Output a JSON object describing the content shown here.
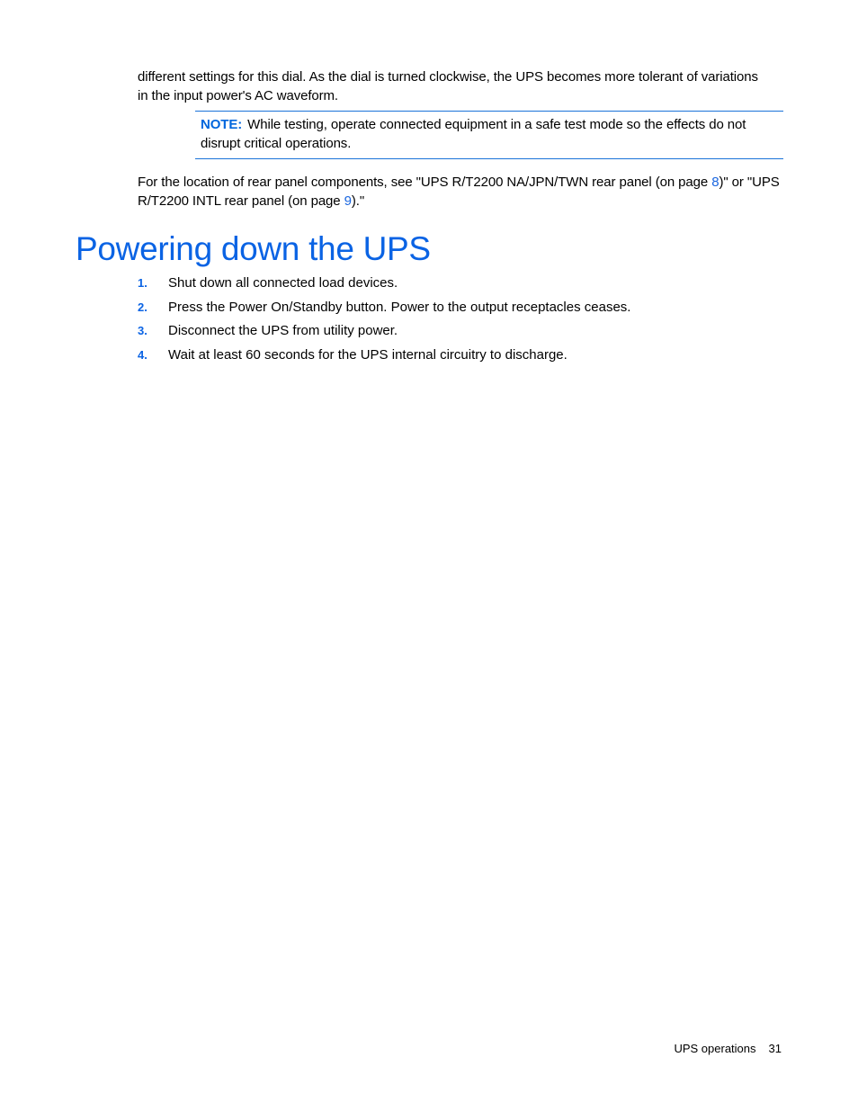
{
  "intro": {
    "line1": "different settings for this dial. As the dial is turned clockwise, the UPS becomes more tolerant of variations",
    "line2": "in the input power's AC waveform."
  },
  "note": {
    "label": "NOTE:",
    "text": "While testing, operate connected equipment in a safe test mode so the effects do not disrupt critical operations."
  },
  "rear_panel": {
    "text_before": "For the location of rear panel components, see \"UPS R/T2200 NA/JPN/TWN rear panel (on page ",
    "link1": "8",
    "text_middle": ")\" or \"UPS R/T2200 INTL rear panel (on page ",
    "link2": "9",
    "text_after": ").\""
  },
  "section": {
    "title": "Powering down the UPS",
    "steps": [
      {
        "num": "1.",
        "text": "Shut down all connected load devices."
      },
      {
        "num": "2.",
        "text": "Press the Power On/Standby button. Power to the output receptacles ceases."
      },
      {
        "num": "3.",
        "text": "Disconnect the UPS from utility power."
      },
      {
        "num": "4.",
        "text": "Wait at least 60 seconds for the UPS internal circuitry to discharge."
      }
    ]
  },
  "footer": {
    "section": "UPS operations",
    "page": "31"
  }
}
